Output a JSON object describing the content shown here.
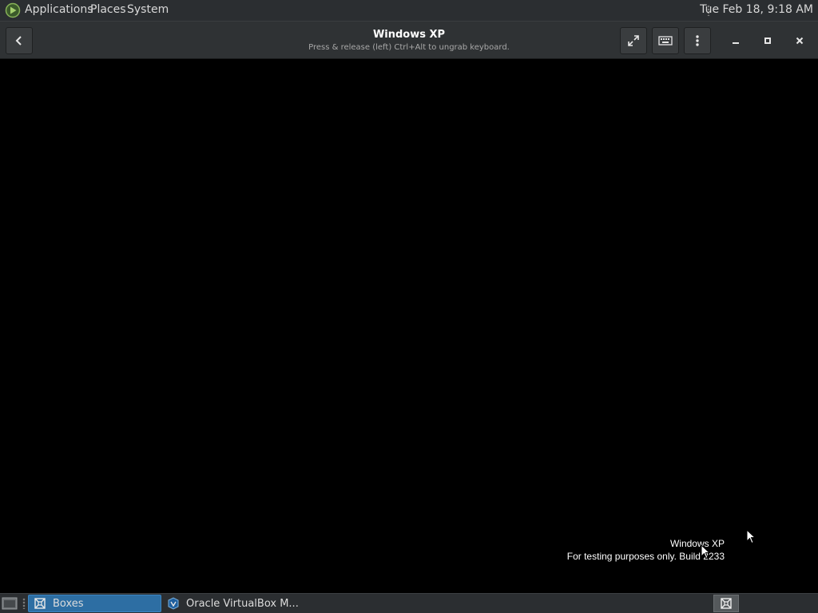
{
  "top_panel": {
    "menus": [
      "Applications",
      "Places",
      "System"
    ],
    "clock": "Tue Feb 18,  9:18 AM"
  },
  "headerbar": {
    "title": "Windows XP",
    "subtitle": "Press & release (left) Ctrl+Alt to ungrab keyboard."
  },
  "vm_screen": {
    "os_name": "Windows XP",
    "build_text": "For testing purposes only. Build 2233"
  },
  "taskbar": {
    "tasks": [
      {
        "label": "Boxes",
        "icon": "boxes-icon",
        "active": true
      },
      {
        "label": "Oracle VirtualBox M...",
        "icon": "virtualbox-icon",
        "active": false
      }
    ]
  },
  "colors": {
    "panel_bg": "#2b2e31",
    "headerbar_bg": "#2f3234",
    "active_task": "#2d6ea3",
    "vm_bg": "#000000"
  }
}
